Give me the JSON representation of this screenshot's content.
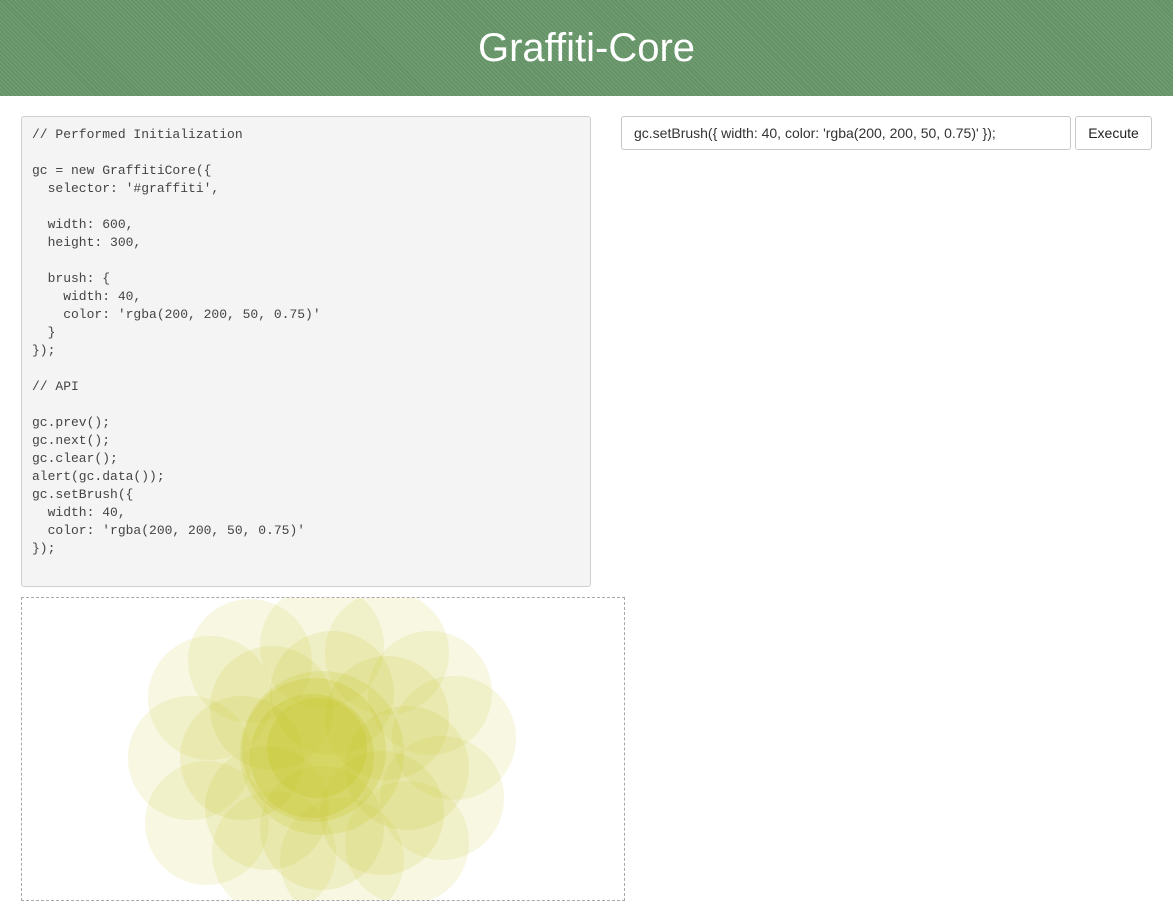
{
  "header": {
    "title": "Graffiti-Core"
  },
  "code_panel": {
    "code": "// Performed Initialization\n\ngc = new GraffitiCore({\n  selector: '#graffiti',\n\n  width: 600,\n  height: 300,\n\n  brush: {\n    width: 40,\n    color: 'rgba(200, 200, 50, 0.75)'\n  }\n});\n\n// API\n\ngc.prev();\ngc.next();\ngc.clear();\nalert(gc.data());\ngc.setBrush({\n  width: 40,\n  color: 'rgba(200, 200, 50, 0.75)'\n});"
  },
  "command": {
    "input_value": "gc.setBrush({ width: 40, color: 'rgba(200, 200, 50, 0.75)' });",
    "execute_label": "Execute"
  },
  "graffiti_canvas": {
    "brush_color": "#c8c832",
    "brush_alpha": 0.75
  }
}
